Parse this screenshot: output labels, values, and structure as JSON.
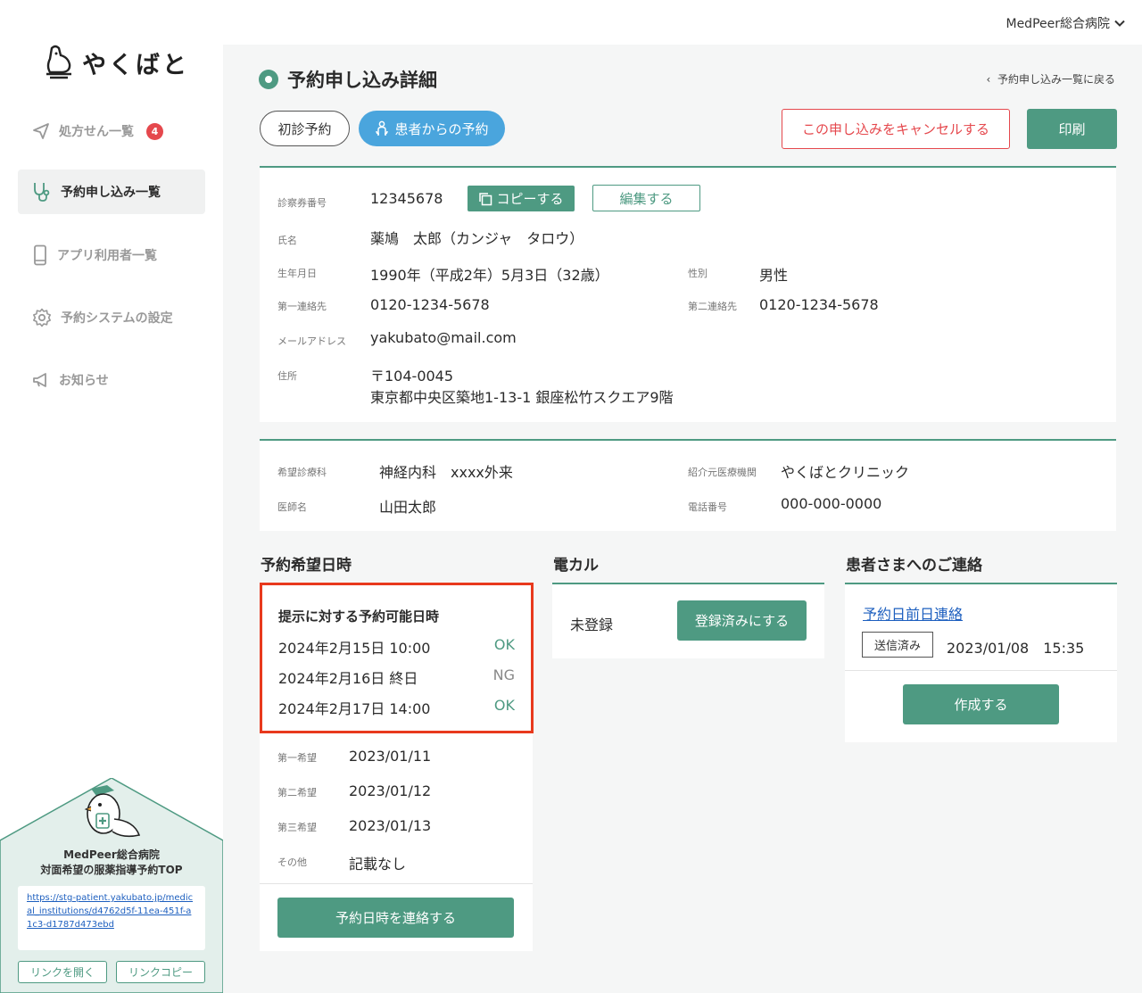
{
  "header": {
    "hospital": "MedPeer総合病院"
  },
  "sidebar": {
    "logo": "やくばと",
    "items": [
      {
        "label": "処方せん一覧",
        "badge": "4",
        "icon": "send-icon"
      },
      {
        "label": "予約申し込み一覧",
        "icon": "stethoscope-icon"
      },
      {
        "label": "アプリ利用者一覧",
        "icon": "phone-icon"
      },
      {
        "label": "予約システムの設定",
        "icon": "gear-icon"
      },
      {
        "label": "お知らせ",
        "icon": "megaphone-icon"
      }
    ],
    "promo": {
      "title1": "MedPeer総合病院",
      "title2": "対面希望の服薬指導予約TOP",
      "url": "https://stg-patient.yakubato.jp/medical_institutions/d4762d5f-11ea-451f-a1c3-d1787d473ebd",
      "open_label": "リンクを開く",
      "copy_label": "リンクコピー"
    }
  },
  "page": {
    "title": "予約申し込み詳細",
    "back": "予約申し込み一覧に戻る",
    "tag_first": "初診予約",
    "tag_patient": "患者からの予約",
    "cancel": "この申し込みをキャンセルする",
    "print": "印刷"
  },
  "patient": {
    "card_no_label": "診察券番号",
    "card_no": "12345678",
    "copy": "コピーする",
    "edit": "編集する",
    "name_label": "氏名",
    "name": "薬鳩　太郎（カンジャ　タロウ）",
    "dob_label": "生年月日",
    "dob": "1990年（平成2年）5月3日（32歳）",
    "sex_label": "性別",
    "sex": "男性",
    "tel1_label": "第一連絡先",
    "tel1": "0120-1234-5678",
    "tel2_label": "第二連絡先",
    "tel2": "0120-1234-5678",
    "mail_label": "メールアドレス",
    "mail": "yakubato@mail.com",
    "addr_label": "住所",
    "zip": "〒104-0045",
    "addr": "東京都中央区築地1-13-1 銀座松竹スクエア9階"
  },
  "medical": {
    "dept_label": "希望診療科",
    "dept": "神経内科　xxxx外来",
    "ref_label": "紹介元医療機関",
    "ref": "やくばとクリニック",
    "doctor_label": "医師名",
    "doctor": "山田太郎",
    "phone_label": "電話番号",
    "phone": "000-000-0000"
  },
  "schedule": {
    "heading": "予約希望日時",
    "box_title": "提示に対する予約可能日時",
    "slots": [
      {
        "date": "2024年2月15日 10:00",
        "status": "OK"
      },
      {
        "date": "2024年2月16日 終日",
        "status": "NG"
      },
      {
        "date": "2024年2月17日 14:00",
        "status": "OK"
      }
    ],
    "prefs": [
      {
        "label": "第一希望",
        "value": "2023/01/11"
      },
      {
        "label": "第二希望",
        "value": "2023/01/12"
      },
      {
        "label": "第三希望",
        "value": "2023/01/13"
      },
      {
        "label": "その他",
        "value": "記載なし"
      }
    ],
    "contact_btn": "予約日時を連絡する"
  },
  "ekaru": {
    "heading": "電カル",
    "status": "未登録",
    "btn": "登録済みにする"
  },
  "notice": {
    "heading": "患者さまへのご連絡",
    "link": "予約日前日連絡",
    "sent": "送信済み",
    "datetime": "2023/01/08　15:35",
    "create": "作成する"
  },
  "colors": {
    "green": "#4e9a82",
    "red": "#e8391d",
    "blue": "#4aa5dd"
  }
}
